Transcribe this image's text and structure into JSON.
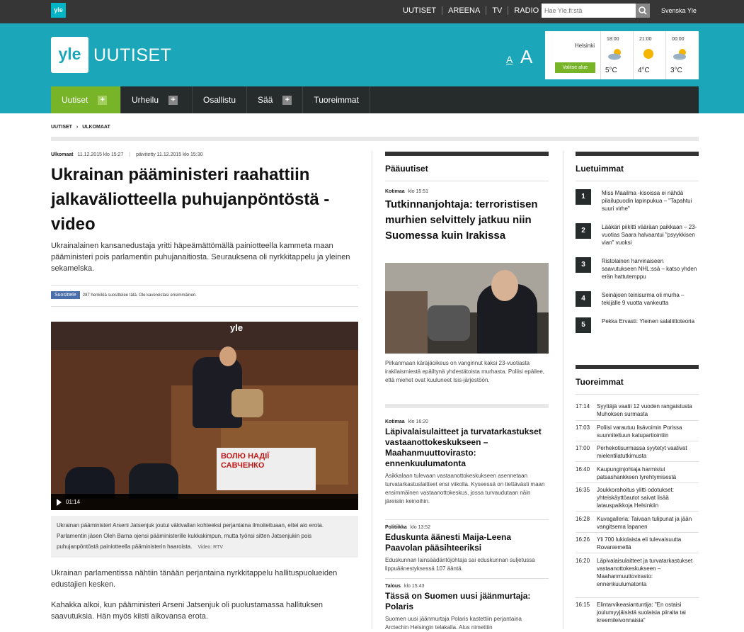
{
  "topbar": {
    "logo": "yle",
    "links": [
      "UUTISET",
      "AREENA",
      "TV",
      "RADIO"
    ],
    "search_placeholder": "Hae Yle.fi:stä",
    "svenska": "Svenska Yle"
  },
  "header": {
    "logo": "yle",
    "section": "UUTISET",
    "font_small": "A",
    "font_big": "A",
    "weather": {
      "city": "Helsinki",
      "button": "Valitse alue",
      "slots": [
        {
          "time": "18:00",
          "temp": "5°C",
          "icon": "partly-cloudy-icon"
        },
        {
          "time": "21:00",
          "temp": "4°C",
          "icon": "sun-icon"
        },
        {
          "time": "00:00",
          "temp": "3°C",
          "icon": "partly-cloudy-icon"
        }
      ]
    }
  },
  "nav": {
    "items": [
      {
        "label": "Uutiset",
        "plus": "+"
      },
      {
        "label": "Urheilu",
        "plus": "+"
      },
      {
        "label": "Osallistu",
        "plus": ""
      },
      {
        "label": "Sää",
        "plus": "+"
      },
      {
        "label": "Tuoreimmat",
        "plus": ""
      }
    ]
  },
  "breadcrumb": [
    "UUTISET",
    "ULKOMAAT"
  ],
  "article": {
    "category": "Ulkomaat",
    "published": "11.12.2015 klo 15:27",
    "updated": "päivitetty 11.12.2015 klo 15:30",
    "title": "Ukrainan pääministeri raahattiin jalkaväliotteella puhujanpöntöstä - video",
    "lead": "Ukrainalainen kansanedustaja yritti häpeämättömällä painiotteella kammeta maan pääministeri pois parlamentin puhujanaitiosta. Seurauksena oli nyrkkitappelu ja yleinen sekamelska.",
    "fb_button": "Suosittele",
    "fb_text": "287 henkilöä suosittelee tätä. Ole kavereistasi ensimmäinen.",
    "video_watermark": "yle",
    "video_banner": "ВОЛЮ НАДІЇ САВЧЕНКО",
    "video_time": "01:14",
    "caption": "Ukrainan pääministeri Arseni Jatsenjuk joutui väkivallan kohteeksi perjantaina ilmoitettuaan, ettei aio erota. Parlamentin jäsen Oleh Barna ojensi pääministerille kukkakimpun, mutta työnsi sitten Jatsenjukin pois puhujanpöntöstä painiotteella pääministerin haaroista.",
    "caption_credit": "Video: RTV",
    "body1": "Ukrainan parlamentissa nähtiin tänään perjantaina nyrkkitappelu hallituspuolueiden edustajien kesken.",
    "body2": "Kahakka alkoi, kun pääministeri Arseni Jatsenjuk oli puolustamassa hallituksen saavutuksia. Hän myös kiisti aikovansa erota."
  },
  "paauutiset": {
    "title": "Pääuutiset",
    "main": {
      "category": "Kotimaa",
      "time": "klo 15:51",
      "headline": "Tutkinnanjohtaja: terroristisen murhien selvittely jatkuu niin Suomessa kuin Irakissa",
      "caption": "Pirkanmaan käräjäoikeus on vanginnut kaksi 23-vuotiasta irakilaismiestä epäiltynä yhdestätoista murhasta. Poliisi epäilee, että miehet ovat kuuluneet Isis-järjestöön."
    },
    "items": [
      {
        "category": "Kotimaa",
        "time": "klo 16:20",
        "headline": "Läpivalaisulaitteet ja turvatarkastukset vastaanottokeskukseen – Maahanmuuttovirasto: ennenkuulumatonta",
        "text": "Asikkalaan tulevaan vastaanottokeskukseen asennetaan turvatarkastuslaitteet ensi viikolla. Kyseessä on tiettävästi maan ensimmäinen vastaanottokeskus, jossa turvaudutaan näin järeisiin keinoihin."
      },
      {
        "category": "Politiikka",
        "time": "klo 13:52",
        "headline": "Eduskunta äänesti Maija-Leena Paavolan pääsihteeriksi",
        "text": "Eduskunnan lainsäädäntöjohtaja sai eduskunnan suljetussa lippuäänestyksessä 107 ääntä."
      },
      {
        "category": "Talous",
        "time": "klo 15:43",
        "headline": "Tässä on Suomen uusi jäänmurtaja: Polaris",
        "text": "Suomen uusi jäänmurtaja Polaris kastettiin perjantaina Arctechin Helsingin telakalla. Alus nimettiin"
      }
    ]
  },
  "luetuimmat": {
    "title": "Luetuimmat",
    "items": [
      {
        "n": "1",
        "text": "Miss Maailma -kisoissa ei nähdä pilailupuodin lapinpukua – \"Tapahtui suuri virhe\""
      },
      {
        "n": "2",
        "text": "Lääkäri piikitti vääräan paikkaan – 23-vuotias Saara halvaantui \"psyykkisen vian\" vuoksi"
      },
      {
        "n": "3",
        "text": "Ristolainen harvinaiseen saavutukseen NHL:ssä – katso yhden erän hattutemppu"
      },
      {
        "n": "4",
        "text": "Seinäjoen teinisurma oli murha – tekijälle 9 vuotta vankeutta"
      },
      {
        "n": "5",
        "text": "Pekka Ervasti: Yleinen salaliittoteoria"
      }
    ]
  },
  "tuoreimmat": {
    "title": "Tuoreimmat",
    "items": [
      {
        "time": "17:14",
        "text": "Syyttäjä vaatii 12 vuoden rangaistusta Muhoksen surmasta"
      },
      {
        "time": "17:03",
        "text": "Poliisi varautuu lisävoimin Porissa suunniteltuun katupartiointiin"
      },
      {
        "time": "17:00",
        "text": "Perhekotisurmassa syytetyt vaativat mielentilatutkimusta"
      },
      {
        "time": "16:40",
        "text": "Kaupunginjohtaja harmistui patsashankkeen tyrehtymisestä"
      },
      {
        "time": "16:35",
        "text": "Joukkorahoitus ylitti odotukset: yhteiskäyttöautot saivat lisää latauspaikkoja Helsinkiin"
      },
      {
        "time": "16:28",
        "text": "Kuvagalleria: Taivaan tulipunat ja jään vangitsema lapanen"
      },
      {
        "time": "16:26",
        "text": "Yli 700 lukiolaista eli tulevaisuutta Rovaniemellä"
      },
      {
        "time": "16:20",
        "text": "Läpivalaisulaitteet ja turvatarkastukset vastaanottokeskukseen – Maahanmuuttovirasto: ennenkuulumatonta"
      },
      {
        "time": "16:15",
        "text": "Elintarvikeasiantuntija: \"En ostaisi joulumyyjäisistä suolaisia piiraita tai kreemileivonnaisia\""
      }
    ]
  }
}
